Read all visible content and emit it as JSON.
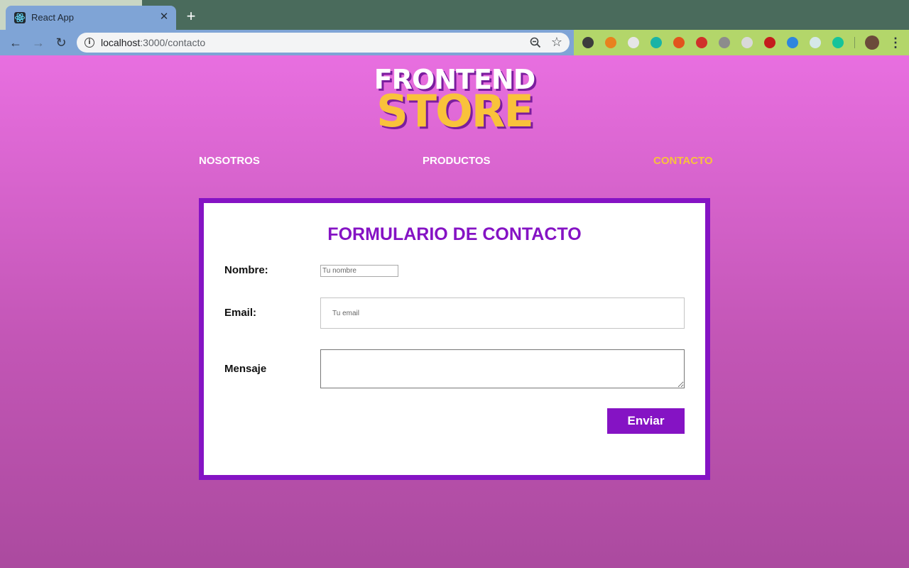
{
  "browser": {
    "tab_title": "React App",
    "tab_close": "✕",
    "new_tab": "+",
    "url_host": "localhost",
    "url_rest": ":3000/contacto",
    "star": "☆",
    "menu": "⋮",
    "back": "←",
    "forward": "→",
    "reload": "↻",
    "extensions": [
      {
        "name": "eyedropper-extension-icon",
        "color": "#3c3c3c"
      },
      {
        "name": "metamask-extension-icon",
        "color": "#e8821e"
      },
      {
        "name": "circle-extension-icon",
        "color": "#e6e6e6"
      },
      {
        "name": "m-extension-icon",
        "color": "#19b3a6"
      },
      {
        "name": "fire-extension-icon",
        "color": "#e2531d"
      },
      {
        "name": "grid-extension-icon",
        "color": "#d0302a"
      },
      {
        "name": "vue-extension-icon",
        "color": "#8c8c8c"
      },
      {
        "name": "target-extension-icon",
        "color": "#d9d9d9"
      },
      {
        "name": "cors-extension-icon",
        "color": "#c41c1c"
      },
      {
        "name": "iq-extension-icon",
        "color": "#2e86de"
      },
      {
        "name": "react-extension-icon",
        "color": "#d5e8e8"
      },
      {
        "name": "grammarly-extension-icon",
        "color": "#15c39a"
      },
      {
        "name": "profile-avatar",
        "color": "#6b4a3a"
      }
    ]
  },
  "logo": {
    "top": "FRONTEND",
    "bottom": "STORE"
  },
  "nav": {
    "items": [
      {
        "label": "NOSOTROS",
        "active": false
      },
      {
        "label": "PRODUCTOS",
        "active": false
      },
      {
        "label": "CONTACTO",
        "active": true
      }
    ]
  },
  "form": {
    "title": "FORMULARIO DE CONTACTO",
    "name_label": "Nombre:",
    "name_placeholder": "Tu nombre",
    "email_label": "Email:",
    "email_placeholder": "Tu email",
    "message_label": "Mensaje",
    "submit_label": "Enviar"
  },
  "colors": {
    "accent": "#8513c4",
    "active_nav": "#f9c23b",
    "page_gradient_top": "#e86fe0",
    "page_gradient_bottom": "#ab4a9f"
  }
}
